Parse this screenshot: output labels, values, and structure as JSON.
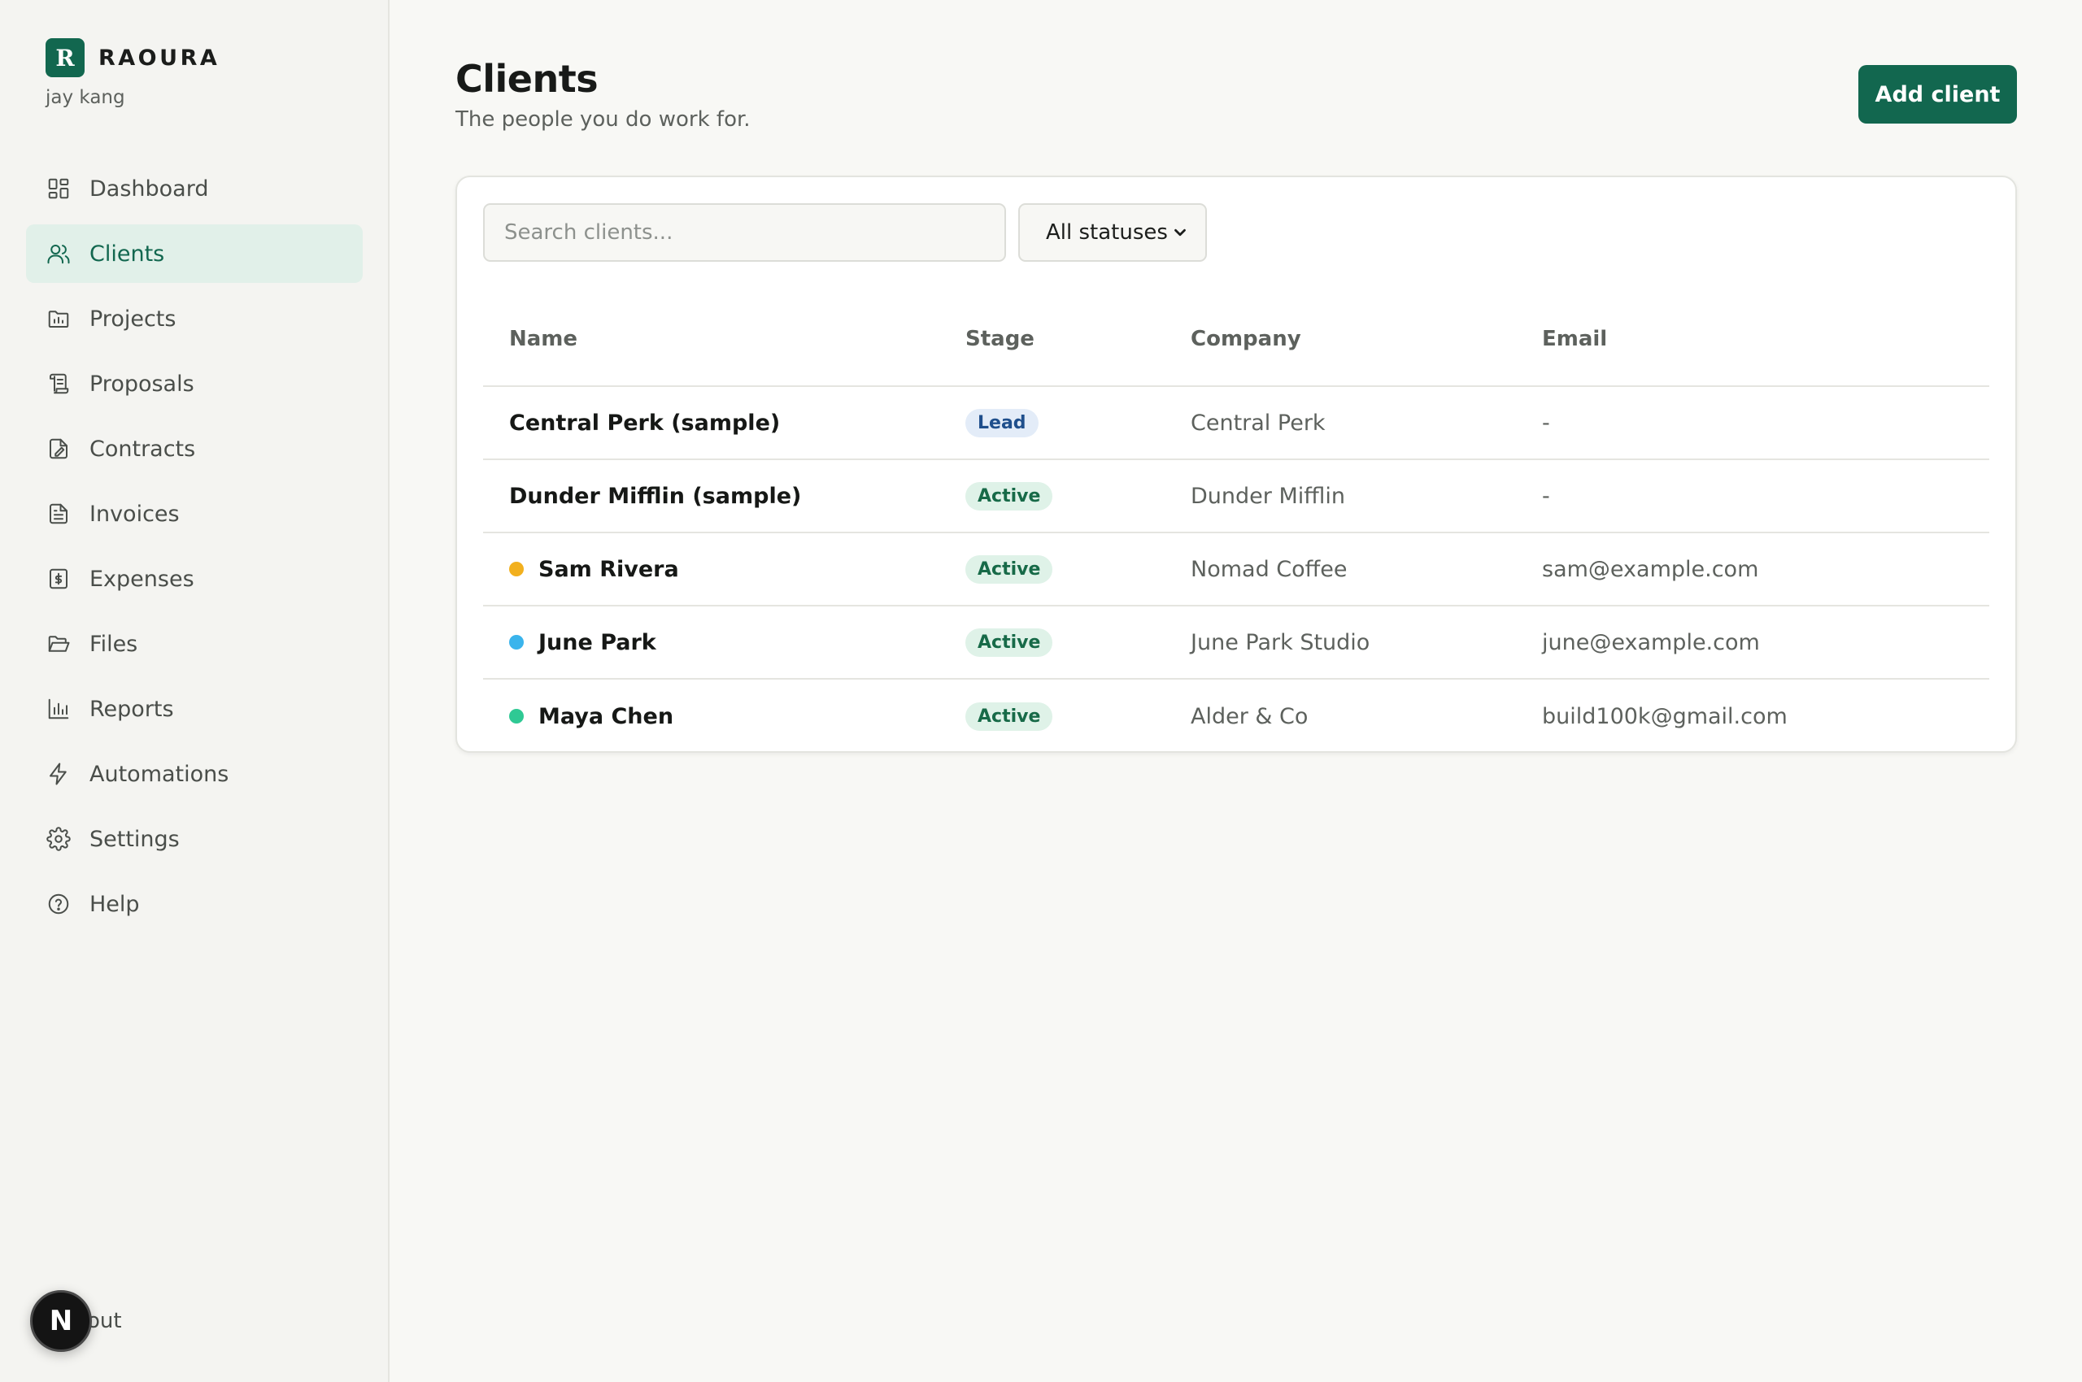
{
  "brand": {
    "logo_letter": "R",
    "name": "RAOURA",
    "user": "jay kang"
  },
  "sidebar": {
    "items": [
      {
        "label": "Dashboard",
        "icon": "dashboard-icon",
        "active": false
      },
      {
        "label": "Clients",
        "icon": "users-icon",
        "active": true
      },
      {
        "label": "Projects",
        "icon": "folder-chart-icon",
        "active": false
      },
      {
        "label": "Proposals",
        "icon": "scroll-icon",
        "active": false
      },
      {
        "label": "Contracts",
        "icon": "file-signature-icon",
        "active": false
      },
      {
        "label": "Invoices",
        "icon": "file-text-icon",
        "active": false
      },
      {
        "label": "Expenses",
        "icon": "receipt-dollar-icon",
        "active": false
      },
      {
        "label": "Files",
        "icon": "folder-open-icon",
        "active": false
      },
      {
        "label": "Reports",
        "icon": "bar-chart-icon",
        "active": false
      },
      {
        "label": "Automations",
        "icon": "lightning-icon",
        "active": false
      },
      {
        "label": "Settings",
        "icon": "gear-icon",
        "active": false
      },
      {
        "label": "Help",
        "icon": "help-circle-icon",
        "active": false
      }
    ],
    "signout_label": "out",
    "next_badge": "N"
  },
  "header": {
    "title": "Clients",
    "subtitle": "The people you do work for.",
    "add_button": "Add client"
  },
  "filters": {
    "search_placeholder": "Search clients...",
    "search_value": "",
    "status_selected": "All statuses"
  },
  "table": {
    "columns": [
      "Name",
      "Stage",
      "Company",
      "Email"
    ],
    "rows": [
      {
        "name": "Central Perk (sample)",
        "dot": "",
        "stage": "Lead",
        "company": "Central Perk",
        "email": "-"
      },
      {
        "name": "Dunder Mifflin (sample)",
        "dot": "",
        "stage": "Active",
        "company": "Dunder Mifflin",
        "email": "-"
      },
      {
        "name": "Sam Rivera",
        "dot": "#f2b01e",
        "stage": "Active",
        "company": "Nomad Coffee",
        "email": "sam@example.com"
      },
      {
        "name": "June Park",
        "dot": "#3ab4ec",
        "stage": "Active",
        "company": "June Park Studio",
        "email": "june@example.com"
      },
      {
        "name": "Maya Chen",
        "dot": "#2fc994",
        "stage": "Active",
        "company": "Alder & Co",
        "email": "build100k@gmail.com"
      }
    ]
  },
  "colors": {
    "accent": "#12674f",
    "active_nav_bg": "#e1f0e9",
    "lead_badge_bg": "#e3ecf8",
    "lead_badge_text": "#1f4f8c",
    "active_badge_bg": "#dff2e8",
    "active_badge_text": "#176a48"
  }
}
